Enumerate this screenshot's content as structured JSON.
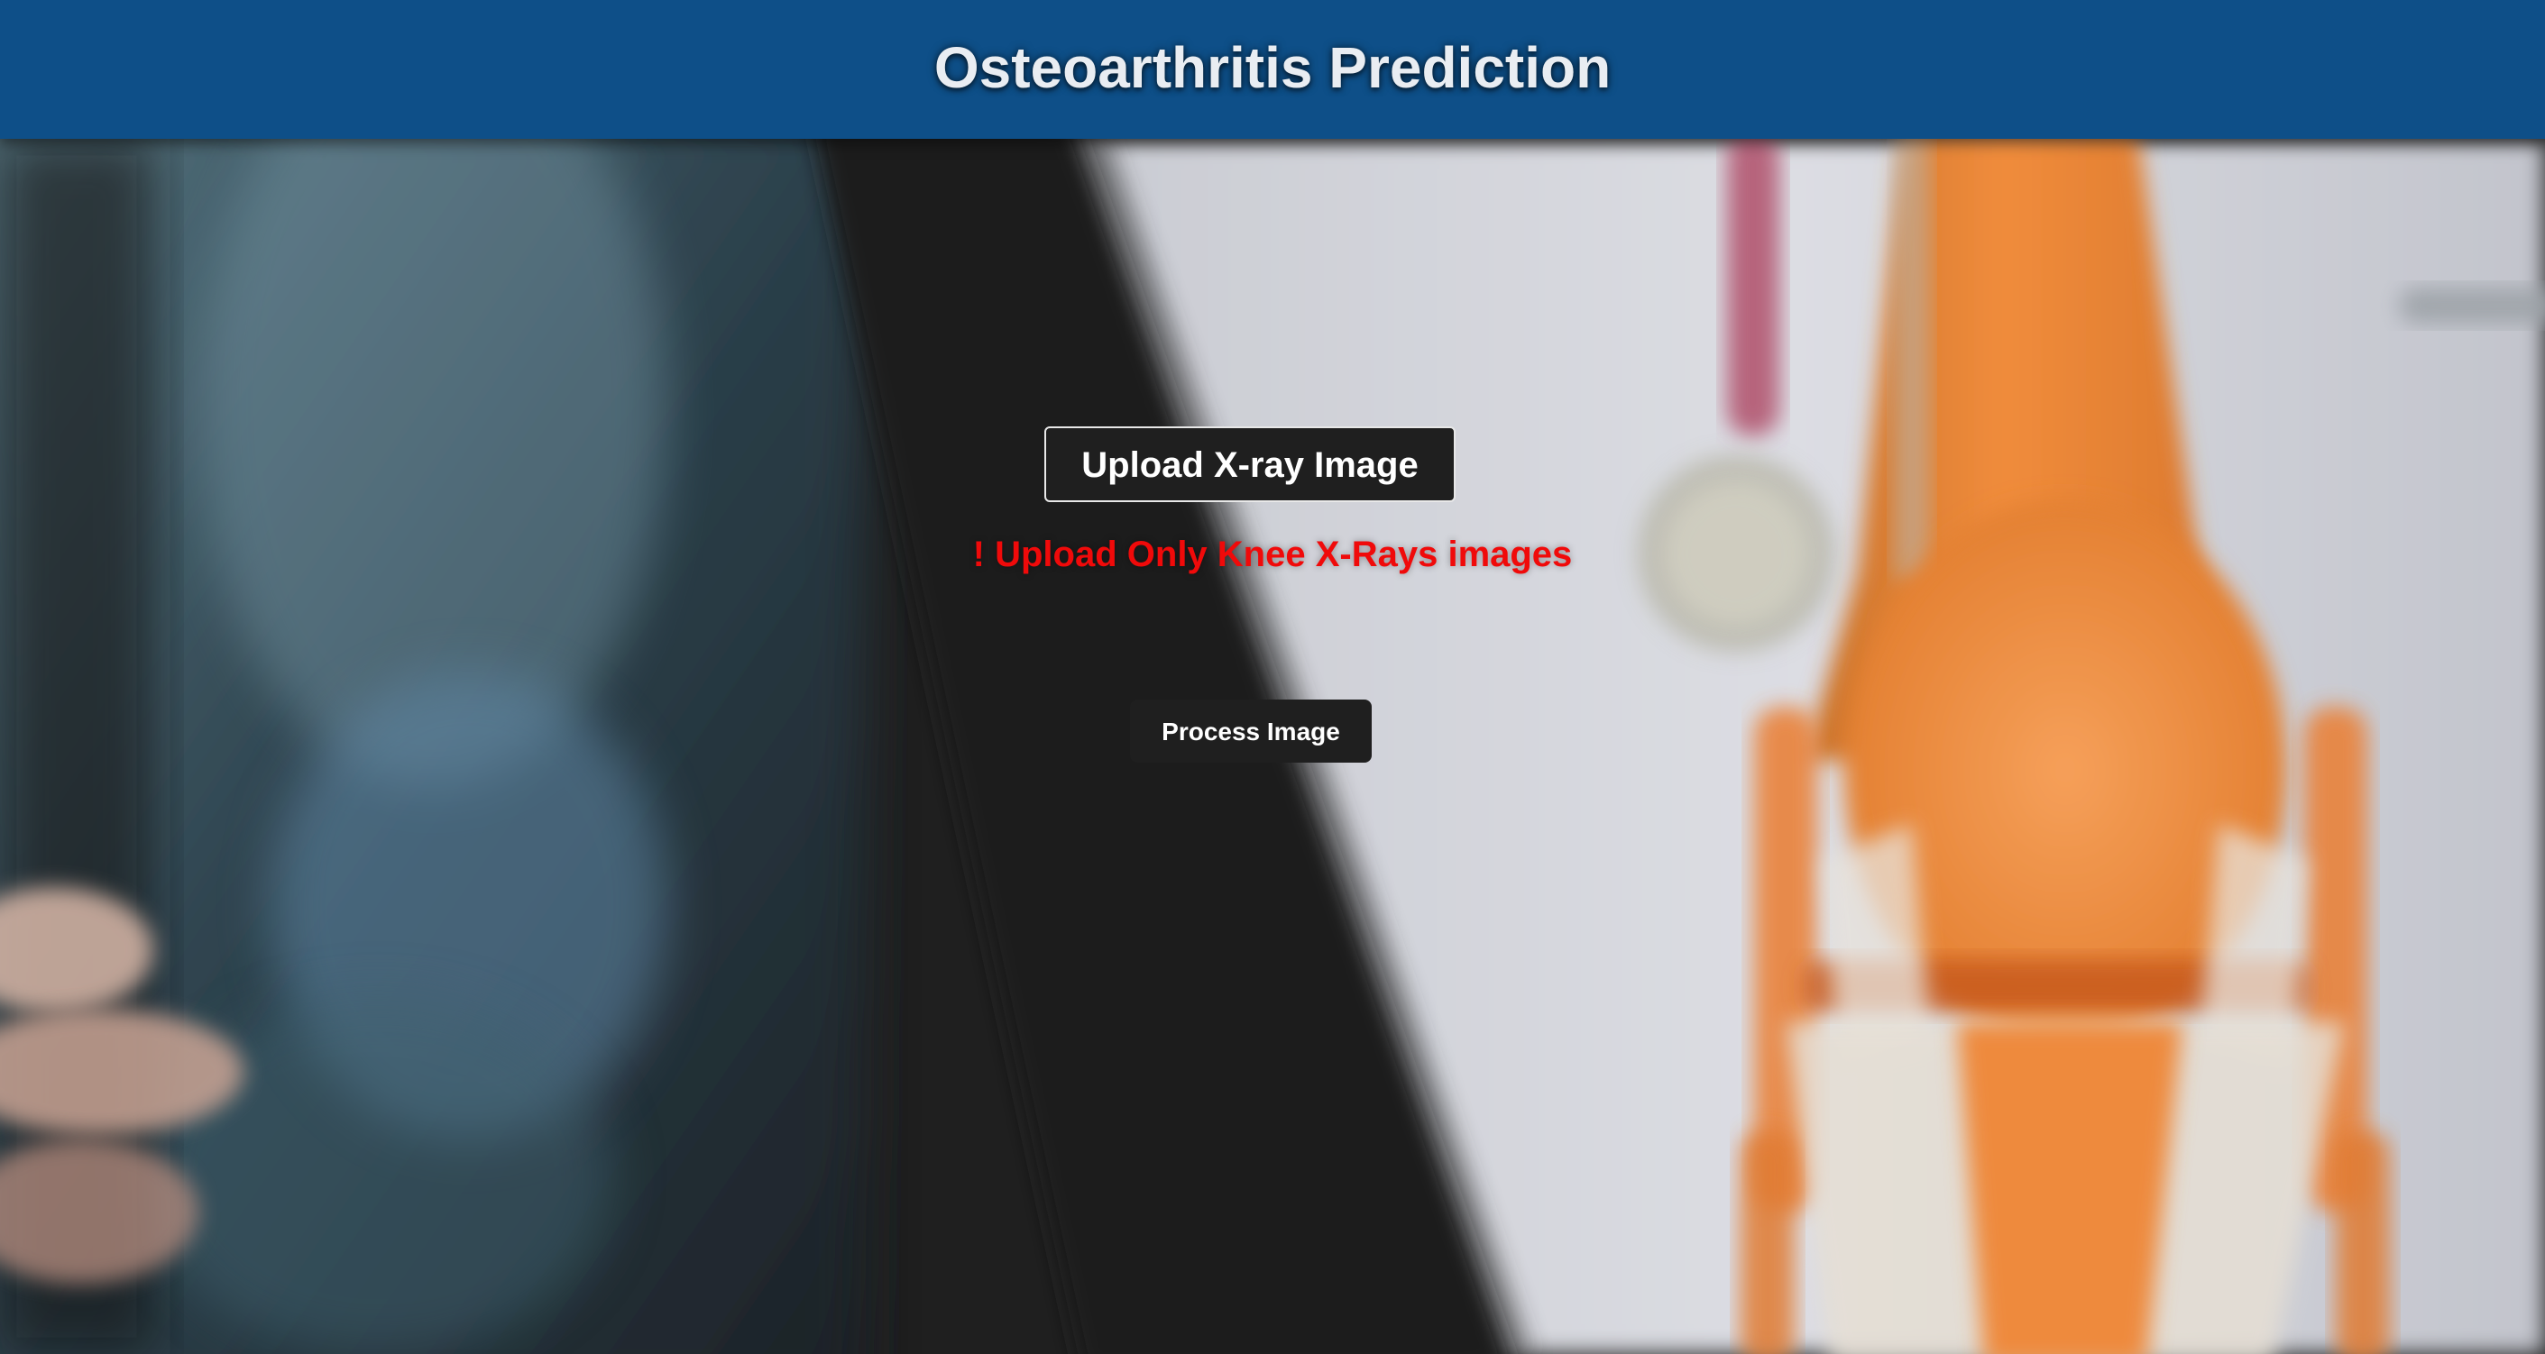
{
  "header": {
    "title": "Osteoarthritis Prediction",
    "background_color": "#0e4f88"
  },
  "main": {
    "upload_button_label": "Upload X-ray Image",
    "warning_text": "! Upload Only Knee X-Rays images",
    "warning_color": "#f00a0a",
    "process_button_label": "Process Image"
  },
  "background_image": {
    "icon": "knee-xray-doctor-photo"
  }
}
